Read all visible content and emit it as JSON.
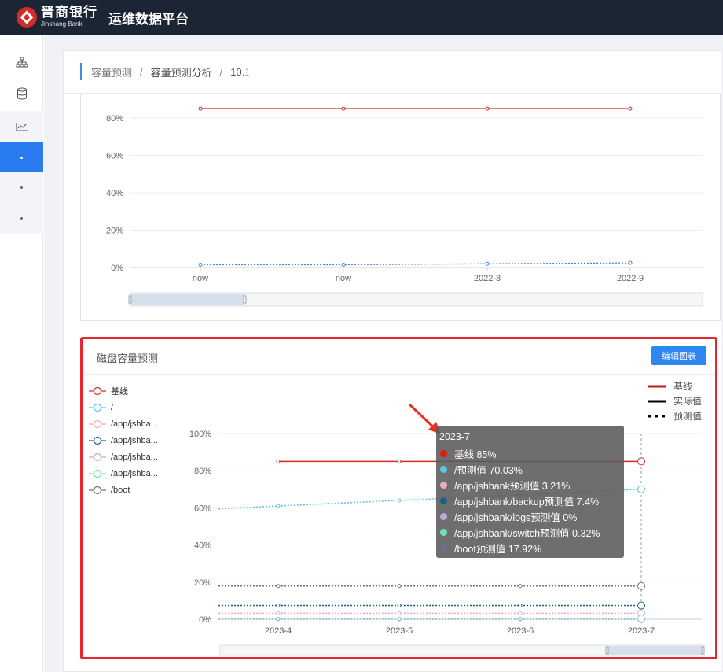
{
  "header": {
    "brand_cn": "晋商银行",
    "brand_en": "Jinshang Bank",
    "platform": "运维数据平台"
  },
  "sidebar": {
    "icons": [
      "sitemap-icon",
      "database-icon",
      "line-chart-icon"
    ],
    "active_color": "#2b7bf0"
  },
  "breadcrumb": [
    "容量预测",
    "容量预测分析",
    "10.1"
  ],
  "top_chart": {
    "ytick_labels": [
      "80%",
      "60%",
      "40%",
      "20%",
      "0%"
    ],
    "xtick_labels": [
      "now",
      "now",
      "2022-8",
      "2022-9"
    ]
  },
  "disk_panel": {
    "title": "磁盘容量预测",
    "edit_button": "编辑图表",
    "series_legend": [
      "基线",
      "/",
      "/app/jshba...",
      "/app/jshba...",
      "/app/jshba...",
      "/app/jshba...",
      "/boot"
    ],
    "line_legend": [
      "基线",
      "实际值",
      "预测值"
    ],
    "ytick_labels": [
      "100%",
      "80%",
      "60%",
      "40%",
      "20%",
      "0%"
    ],
    "xtick_labels": [
      "2023-4",
      "2023-5",
      "2023-6",
      "2023-7"
    ]
  },
  "tooltip": {
    "title": "2023-7",
    "rows": [
      {
        "text": "基线 85%",
        "color": "#e8180f"
      },
      {
        "text": "/预测值 70.03%",
        "color": "#5ec3e8"
      },
      {
        "text": "/app/jshbank预测值 3.21%",
        "color": "#f0a8c8"
      },
      {
        "text": "/app/jshbank/backup预测值 7.4%",
        "color": "#1c5f86"
      },
      {
        "text": "/app/jshbank/logs预测值 0%",
        "color": "#c0a8e0"
      },
      {
        "text": "/app/jshbank/switch预测值 0.32%",
        "color": "#6ee0c0"
      },
      {
        "text": "/boot预测值 17.92%",
        "color": "#6a7090"
      }
    ]
  },
  "chart_data": [
    {
      "type": "line",
      "x": [
        "now",
        "now",
        "2022-8",
        "2022-9"
      ],
      "ylim": [
        0,
        80
      ],
      "series": [
        {
          "values": [
            85,
            85,
            85,
            85
          ],
          "color": "#d42a2a"
        },
        {
          "values": [
            1.5,
            1.5,
            2,
            2.5
          ],
          "color": "#4a86e8"
        }
      ]
    },
    {
      "type": "line",
      "x": [
        "2023-4",
        "2023-5",
        "2023-6",
        "2023-7"
      ],
      "ylim": [
        0,
        100
      ],
      "series": [
        {
          "name": "基线",
          "values": [
            85,
            85,
            85,
            85
          ],
          "color": "#d42a2a"
        },
        {
          "name": "/",
          "values": [
            61,
            64,
            67,
            70.03
          ],
          "color": "#5ec3e8"
        },
        {
          "name": "/app/jshba...",
          "values": [
            3.21,
            3.21,
            3.21,
            3.21
          ],
          "color": "#f0a8c8"
        },
        {
          "name": "/app/jshba...",
          "values": [
            7.4,
            7.4,
            7.4,
            7.4
          ],
          "color": "#1c5f86"
        },
        {
          "name": "/app/jshba...",
          "values": [
            0,
            0,
            0,
            0
          ],
          "color": "#c0a8e0"
        },
        {
          "name": "/app/jshba...",
          "values": [
            0.32,
            0.32,
            0.32,
            0.32
          ],
          "color": "#6ee0c0"
        },
        {
          "name": "/boot",
          "values": [
            17.92,
            17.92,
            17.92,
            17.92
          ],
          "color": "#6a7090"
        }
      ]
    }
  ]
}
